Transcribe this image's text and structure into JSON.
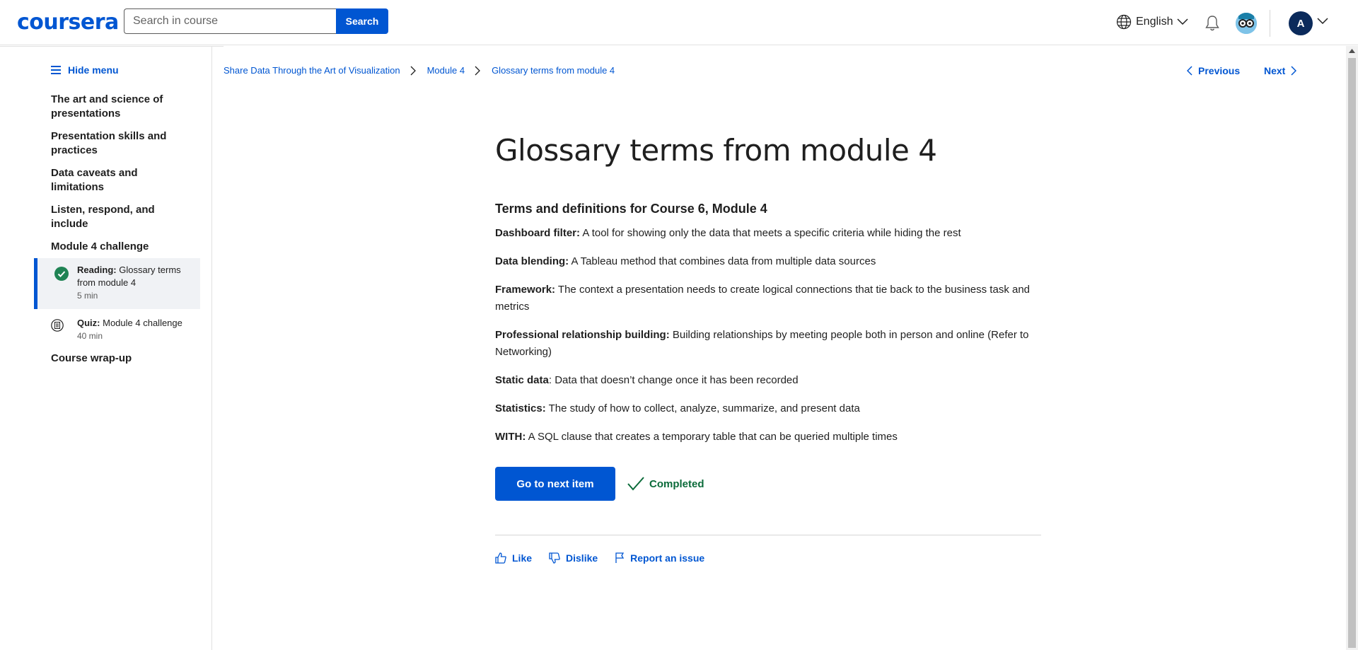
{
  "header": {
    "logo": "coursera",
    "search_placeholder": "Search in course",
    "search_button": "Search",
    "language": "English",
    "avatar_initial": "A",
    "accent": "#0056d2"
  },
  "sidebar": {
    "hide_menu": "Hide menu",
    "sections": [
      "The art and science of presentations",
      "Presentation skills and practices",
      "Data caveats and limitations",
      "Listen, respond, and include",
      "Module 4 challenge"
    ],
    "items": [
      {
        "type": "Reading:",
        "title": "Glossary terms from module 4",
        "duration": "5 min",
        "icon": "check-circle-icon",
        "active": true
      },
      {
        "type": "Quiz:",
        "title": "Module 4 challenge",
        "duration": "40 min",
        "icon": "quiz-icon",
        "active": false
      }
    ],
    "last_section": "Course wrap-up"
  },
  "breadcrumb": [
    "Share Data Through the Art of Visualization",
    "Module 4",
    "Glossary terms from module 4"
  ],
  "nav": {
    "previous": "Previous",
    "next": "Next"
  },
  "main": {
    "title": "Glossary terms from module 4",
    "subheading": "Terms and definitions for Course 6, Module 4",
    "terms": [
      {
        "term": "Dashboard filter:",
        "definition": " A tool for showing only the data that meets a specific criteria while hiding the rest"
      },
      {
        "term": "Data blending:",
        "definition": " A Tableau method that combines data from multiple data sources"
      },
      {
        "term": "Framework:",
        "definition": " The context a presentation needs to create logical connections that tie back to the business task and metrics"
      },
      {
        "term": "Professional relationship building:",
        "definition": " Building relationships by meeting people both in person and online (Refer to Networking)"
      },
      {
        "term": "Static data",
        "definition": ": Data that doesn’t change once it has been recorded"
      },
      {
        "term": "Statistics:",
        "definition": " The study of how to collect, analyze, summarize, and present data"
      },
      {
        "term": "WITH:",
        "definition": " A SQL clause that creates a temporary table that can be queried multiple times"
      }
    ],
    "next_button": "Go to next item",
    "completed_label": "Completed",
    "completed_color": "#0b6b3a",
    "feedback": {
      "like": "Like",
      "dislike": "Dislike",
      "report": "Report an issue"
    }
  }
}
